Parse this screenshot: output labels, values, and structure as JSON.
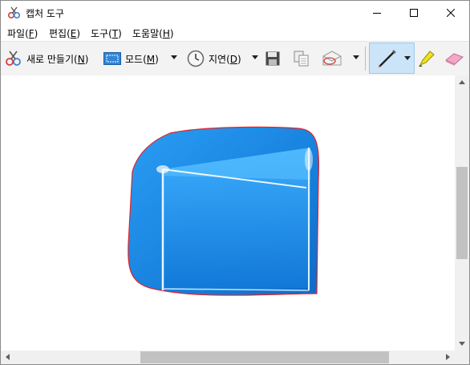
{
  "window": {
    "title": "캡처 도구",
    "icon": "scissors-icon"
  },
  "menu": {
    "file": {
      "text": "파일(",
      "key": "F",
      "end": ")"
    },
    "edit": {
      "text": "편집(",
      "key": "E",
      "end": ")"
    },
    "tools": {
      "text": "도구(",
      "key": "T",
      "end": ")"
    },
    "help": {
      "text": "도움말(",
      "key": "H",
      "end": ")"
    }
  },
  "toolbar": {
    "new": {
      "text": "새로 만들기(",
      "key": "N",
      "end": ")"
    },
    "mode": {
      "text": "모드(",
      "key": "M",
      "end": ")"
    },
    "delay": {
      "text": "지연(",
      "key": "D",
      "end": ")"
    }
  },
  "colors": {
    "pen_selected_bg": "#cce4f7",
    "capture_border": "#e0242a",
    "capture_blue": "#1e88e5"
  }
}
